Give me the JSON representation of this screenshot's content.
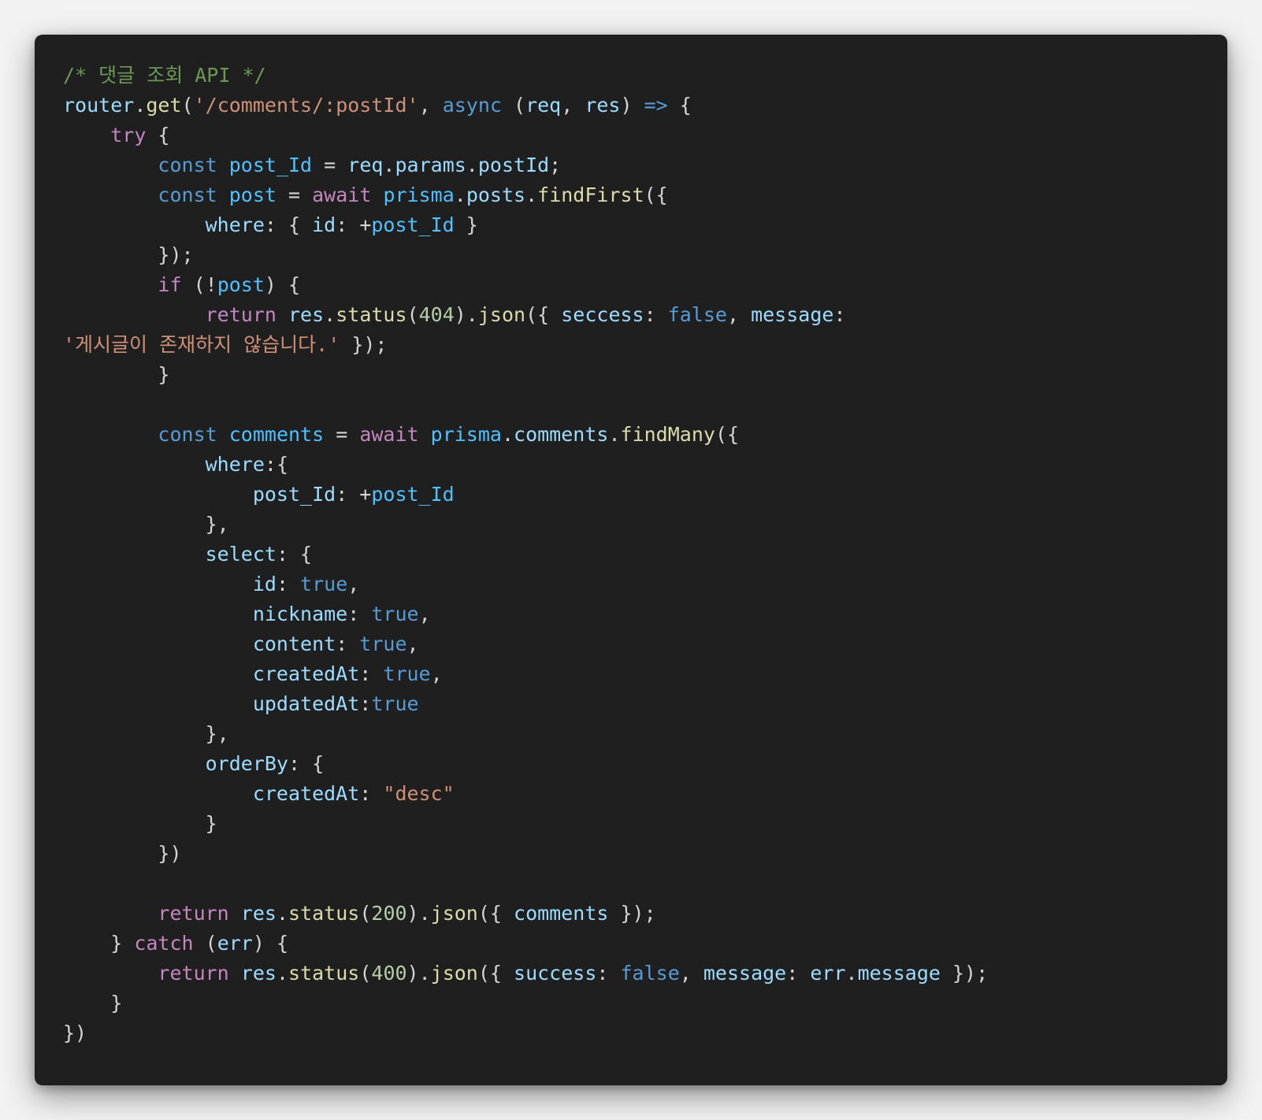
{
  "code": {
    "language": "javascript",
    "theme_colors": {
      "background": "#1f1f1f",
      "page_background": "#f2f2f2",
      "comment": "#6a9955",
      "string": "#ce9178",
      "keyword": "#569cd6",
      "control": "#c586c0",
      "variable": "#9cdcfe",
      "constant": "#4fc1ff",
      "function": "#dcdcaa",
      "number": "#b5cea8",
      "punctuation": "#d4d4d4"
    },
    "lines": [
      [
        [
          "com",
          "/* 댓글 조회 API */"
        ]
      ],
      [
        [
          "var",
          "router"
        ],
        [
          "pun",
          "."
        ],
        [
          "fn",
          "get"
        ],
        [
          "pun",
          "("
        ],
        [
          "str",
          "'/comments/:postId'"
        ],
        [
          "pun",
          ", "
        ],
        [
          "kw",
          "async"
        ],
        [
          "pun",
          " ("
        ],
        [
          "var",
          "req"
        ],
        [
          "pun",
          ", "
        ],
        [
          "var",
          "res"
        ],
        [
          "pun",
          ") "
        ],
        [
          "kw",
          "=>"
        ],
        [
          "pun",
          " {"
        ]
      ],
      [
        [
          "pun",
          "    "
        ],
        [
          "ctl",
          "try"
        ],
        [
          "pun",
          " {"
        ]
      ],
      [
        [
          "pun",
          "        "
        ],
        [
          "kw",
          "const"
        ],
        [
          "pun",
          " "
        ],
        [
          "con",
          "post_Id"
        ],
        [
          "pun",
          " = "
        ],
        [
          "var",
          "req"
        ],
        [
          "pun",
          "."
        ],
        [
          "var",
          "params"
        ],
        [
          "pun",
          "."
        ],
        [
          "var",
          "postId"
        ],
        [
          "pun",
          ";"
        ]
      ],
      [
        [
          "pun",
          "        "
        ],
        [
          "kw",
          "const"
        ],
        [
          "pun",
          " "
        ],
        [
          "con",
          "post"
        ],
        [
          "pun",
          " = "
        ],
        [
          "ctl",
          "await"
        ],
        [
          "pun",
          " "
        ],
        [
          "con",
          "prisma"
        ],
        [
          "pun",
          "."
        ],
        [
          "var",
          "posts"
        ],
        [
          "pun",
          "."
        ],
        [
          "fn",
          "findFirst"
        ],
        [
          "pun",
          "({"
        ]
      ],
      [
        [
          "pun",
          "            "
        ],
        [
          "var",
          "where"
        ],
        [
          "pun",
          ": { "
        ],
        [
          "var",
          "id"
        ],
        [
          "pun",
          ": +"
        ],
        [
          "con",
          "post_Id"
        ],
        [
          "pun",
          " }"
        ]
      ],
      [
        [
          "pun",
          "        });"
        ]
      ],
      [
        [
          "pun",
          "        "
        ],
        [
          "ctl",
          "if"
        ],
        [
          "pun",
          " (!"
        ],
        [
          "con",
          "post"
        ],
        [
          "pun",
          ") {"
        ]
      ],
      [
        [
          "pun",
          "            "
        ],
        [
          "ctl",
          "return"
        ],
        [
          "pun",
          " "
        ],
        [
          "var",
          "res"
        ],
        [
          "pun",
          "."
        ],
        [
          "fn",
          "status"
        ],
        [
          "pun",
          "("
        ],
        [
          "num",
          "404"
        ],
        [
          "pun",
          ")."
        ],
        [
          "fn",
          "json"
        ],
        [
          "pun",
          "({ "
        ],
        [
          "var",
          "seccess"
        ],
        [
          "pun",
          ": "
        ],
        [
          "kw",
          "false"
        ],
        [
          "pun",
          ", "
        ],
        [
          "var",
          "message"
        ],
        [
          "pun",
          ":"
        ]
      ],
      [
        [
          "str",
          "'게시글이 존재하지 않습니다.'"
        ],
        [
          "pun",
          " });"
        ]
      ],
      [
        [
          "pun",
          "        }"
        ]
      ],
      [
        [
          "pun",
          ""
        ]
      ],
      [
        [
          "pun",
          "        "
        ],
        [
          "kw",
          "const"
        ],
        [
          "pun",
          " "
        ],
        [
          "con",
          "comments"
        ],
        [
          "pun",
          " = "
        ],
        [
          "ctl",
          "await"
        ],
        [
          "pun",
          " "
        ],
        [
          "con",
          "prisma"
        ],
        [
          "pun",
          "."
        ],
        [
          "var",
          "comments"
        ],
        [
          "pun",
          "."
        ],
        [
          "fn",
          "findMany"
        ],
        [
          "pun",
          "({"
        ]
      ],
      [
        [
          "pun",
          "            "
        ],
        [
          "var",
          "where"
        ],
        [
          "pun",
          ":{"
        ]
      ],
      [
        [
          "pun",
          "                "
        ],
        [
          "var",
          "post_Id"
        ],
        [
          "pun",
          ": +"
        ],
        [
          "con",
          "post_Id"
        ]
      ],
      [
        [
          "pun",
          "            },"
        ]
      ],
      [
        [
          "pun",
          "            "
        ],
        [
          "var",
          "select"
        ],
        [
          "pun",
          ": {"
        ]
      ],
      [
        [
          "pun",
          "                "
        ],
        [
          "var",
          "id"
        ],
        [
          "pun",
          ": "
        ],
        [
          "kw",
          "true"
        ],
        [
          "pun",
          ","
        ]
      ],
      [
        [
          "pun",
          "                "
        ],
        [
          "var",
          "nickname"
        ],
        [
          "pun",
          ": "
        ],
        [
          "kw",
          "true"
        ],
        [
          "pun",
          ","
        ]
      ],
      [
        [
          "pun",
          "                "
        ],
        [
          "var",
          "content"
        ],
        [
          "pun",
          ": "
        ],
        [
          "kw",
          "true"
        ],
        [
          "pun",
          ","
        ]
      ],
      [
        [
          "pun",
          "                "
        ],
        [
          "var",
          "createdAt"
        ],
        [
          "pun",
          ": "
        ],
        [
          "kw",
          "true"
        ],
        [
          "pun",
          ","
        ]
      ],
      [
        [
          "pun",
          "                "
        ],
        [
          "var",
          "updatedAt"
        ],
        [
          "pun",
          ":"
        ],
        [
          "kw",
          "true"
        ]
      ],
      [
        [
          "pun",
          "            },"
        ]
      ],
      [
        [
          "pun",
          "            "
        ],
        [
          "var",
          "orderBy"
        ],
        [
          "pun",
          ": {"
        ]
      ],
      [
        [
          "pun",
          "                "
        ],
        [
          "var",
          "createdAt"
        ],
        [
          "pun",
          ": "
        ],
        [
          "str",
          "\"desc\""
        ]
      ],
      [
        [
          "pun",
          "            }"
        ]
      ],
      [
        [
          "pun",
          "        })"
        ]
      ],
      [
        [
          "pun",
          ""
        ]
      ],
      [
        [
          "pun",
          "        "
        ],
        [
          "ctl",
          "return"
        ],
        [
          "pun",
          " "
        ],
        [
          "var",
          "res"
        ],
        [
          "pun",
          "."
        ],
        [
          "fn",
          "status"
        ],
        [
          "pun",
          "("
        ],
        [
          "num",
          "200"
        ],
        [
          "pun",
          ")."
        ],
        [
          "fn",
          "json"
        ],
        [
          "pun",
          "({ "
        ],
        [
          "var",
          "comments"
        ],
        [
          "pun",
          " });"
        ]
      ],
      [
        [
          "pun",
          "    } "
        ],
        [
          "ctl",
          "catch"
        ],
        [
          "pun",
          " ("
        ],
        [
          "var",
          "err"
        ],
        [
          "pun",
          ") {"
        ]
      ],
      [
        [
          "pun",
          "        "
        ],
        [
          "ctl",
          "return"
        ],
        [
          "pun",
          " "
        ],
        [
          "var",
          "res"
        ],
        [
          "pun",
          "."
        ],
        [
          "fn",
          "status"
        ],
        [
          "pun",
          "("
        ],
        [
          "num",
          "400"
        ],
        [
          "pun",
          ")."
        ],
        [
          "fn",
          "json"
        ],
        [
          "pun",
          "({ "
        ],
        [
          "var",
          "success"
        ],
        [
          "pun",
          ": "
        ],
        [
          "kw",
          "false"
        ],
        [
          "pun",
          ", "
        ],
        [
          "var",
          "message"
        ],
        [
          "pun",
          ": "
        ],
        [
          "var",
          "err"
        ],
        [
          "pun",
          "."
        ],
        [
          "var",
          "message"
        ],
        [
          "pun",
          " });"
        ]
      ],
      [
        [
          "pun",
          "    }"
        ]
      ],
      [
        [
          "pun",
          "})"
        ]
      ]
    ]
  }
}
